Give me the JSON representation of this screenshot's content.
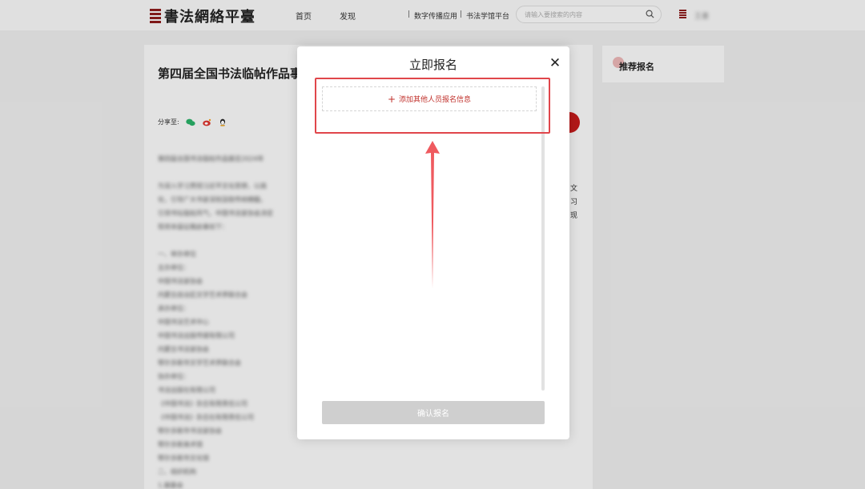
{
  "header": {
    "logo_text": "書法網絡平臺",
    "nav": [
      "首页",
      "发现"
    ],
    "links": [
      "数字传播应用",
      "书法学馆平台"
    ],
    "separators": [
      "|",
      "|"
    ],
    "search_placeholder": "请输入要搜索的内容",
    "search_icon": "search-icon",
    "user_name": "王書"
  },
  "article": {
    "title": "第四届全国书法临帖作品事",
    "share_label": "分享至:",
    "share_icons": [
      "wechat-icon",
      "weibo-icon",
      "qq-icon"
    ],
    "side_fragments": [
      "文",
      "习",
      "现"
    ],
    "body_lines": [
      "第四届全国书法临帖作品展览2024年",
      "",
      "为深入学习贯彻习近平文化思想，以高",
      "化，引导广大书家深刻汲取传统精髓，",
      "引领书坛临帖风气，中国书法家协会决定",
      "现将本届征稿启事如下：",
      "",
      "一、举办单位",
      "主办单位：",
      "中国书法家协会",
      "内蒙古自治区文学艺术界联合会",
      "承办单位：",
      "中国书法艺术中心",
      "中国书法出版传媒有限公司",
      "内蒙古书法家协会",
      "鄂尔多斯市文学艺术界联合会",
      "协办单位：",
      "书法出版社有限公司",
      "《中国书法》杂志有限责任公司",
      "《中国书法》杂志社有限责任公司",
      "鄂尔多斯市书法家协会",
      "鄂尔多斯美术馆",
      "鄂尔多斯市文化馆",
      "二、组织机构",
      "1.展委会"
    ]
  },
  "sidebar": {
    "recommend_title": "推荐报名"
  },
  "modal": {
    "title": "立即报名",
    "close_symbol": "✕",
    "add_label": "添加其他人员报名信息",
    "add_plus": "+",
    "confirm_label": "确认报名"
  },
  "colors": {
    "accent_red": "#c0302b",
    "annotation_red": "#e0464b",
    "disabled_button": "#cfcfcf"
  }
}
